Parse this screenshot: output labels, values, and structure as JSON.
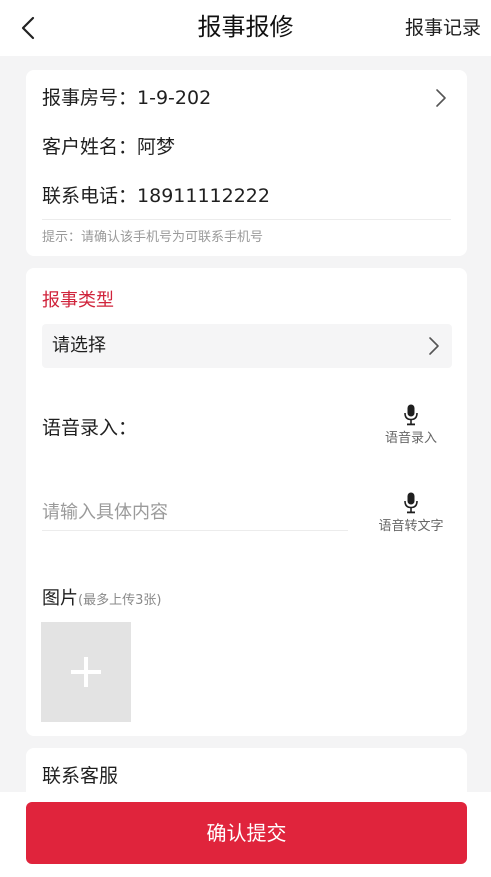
{
  "header": {
    "title": "报事报修",
    "records_link": "报事记录",
    "back_icon": "chevron-left-icon"
  },
  "info": {
    "room_label": "报事房号：",
    "room_value": "1-9-202",
    "name_label": "客户姓名：",
    "name_value": "阿梦",
    "phone_label": "联系电话：",
    "phone_value": "18911112222",
    "hint": "提示：请确认该手机号为可联系手机号"
  },
  "report": {
    "type_title": "报事类型",
    "type_placeholder": "请选择",
    "voice_label": "语音录入：",
    "voice_button": "语音录入",
    "content_placeholder": "请输入具体内容",
    "voice_to_text_button": "语音转文字",
    "image_title": "图片",
    "image_note": "(最多上传3张)"
  },
  "service": {
    "label": "联系客服"
  },
  "footer": {
    "submit_label": "确认提交"
  },
  "colors": {
    "accent": "#e0243c",
    "section_title": "#d0233b",
    "background": "#f4f4f5"
  }
}
